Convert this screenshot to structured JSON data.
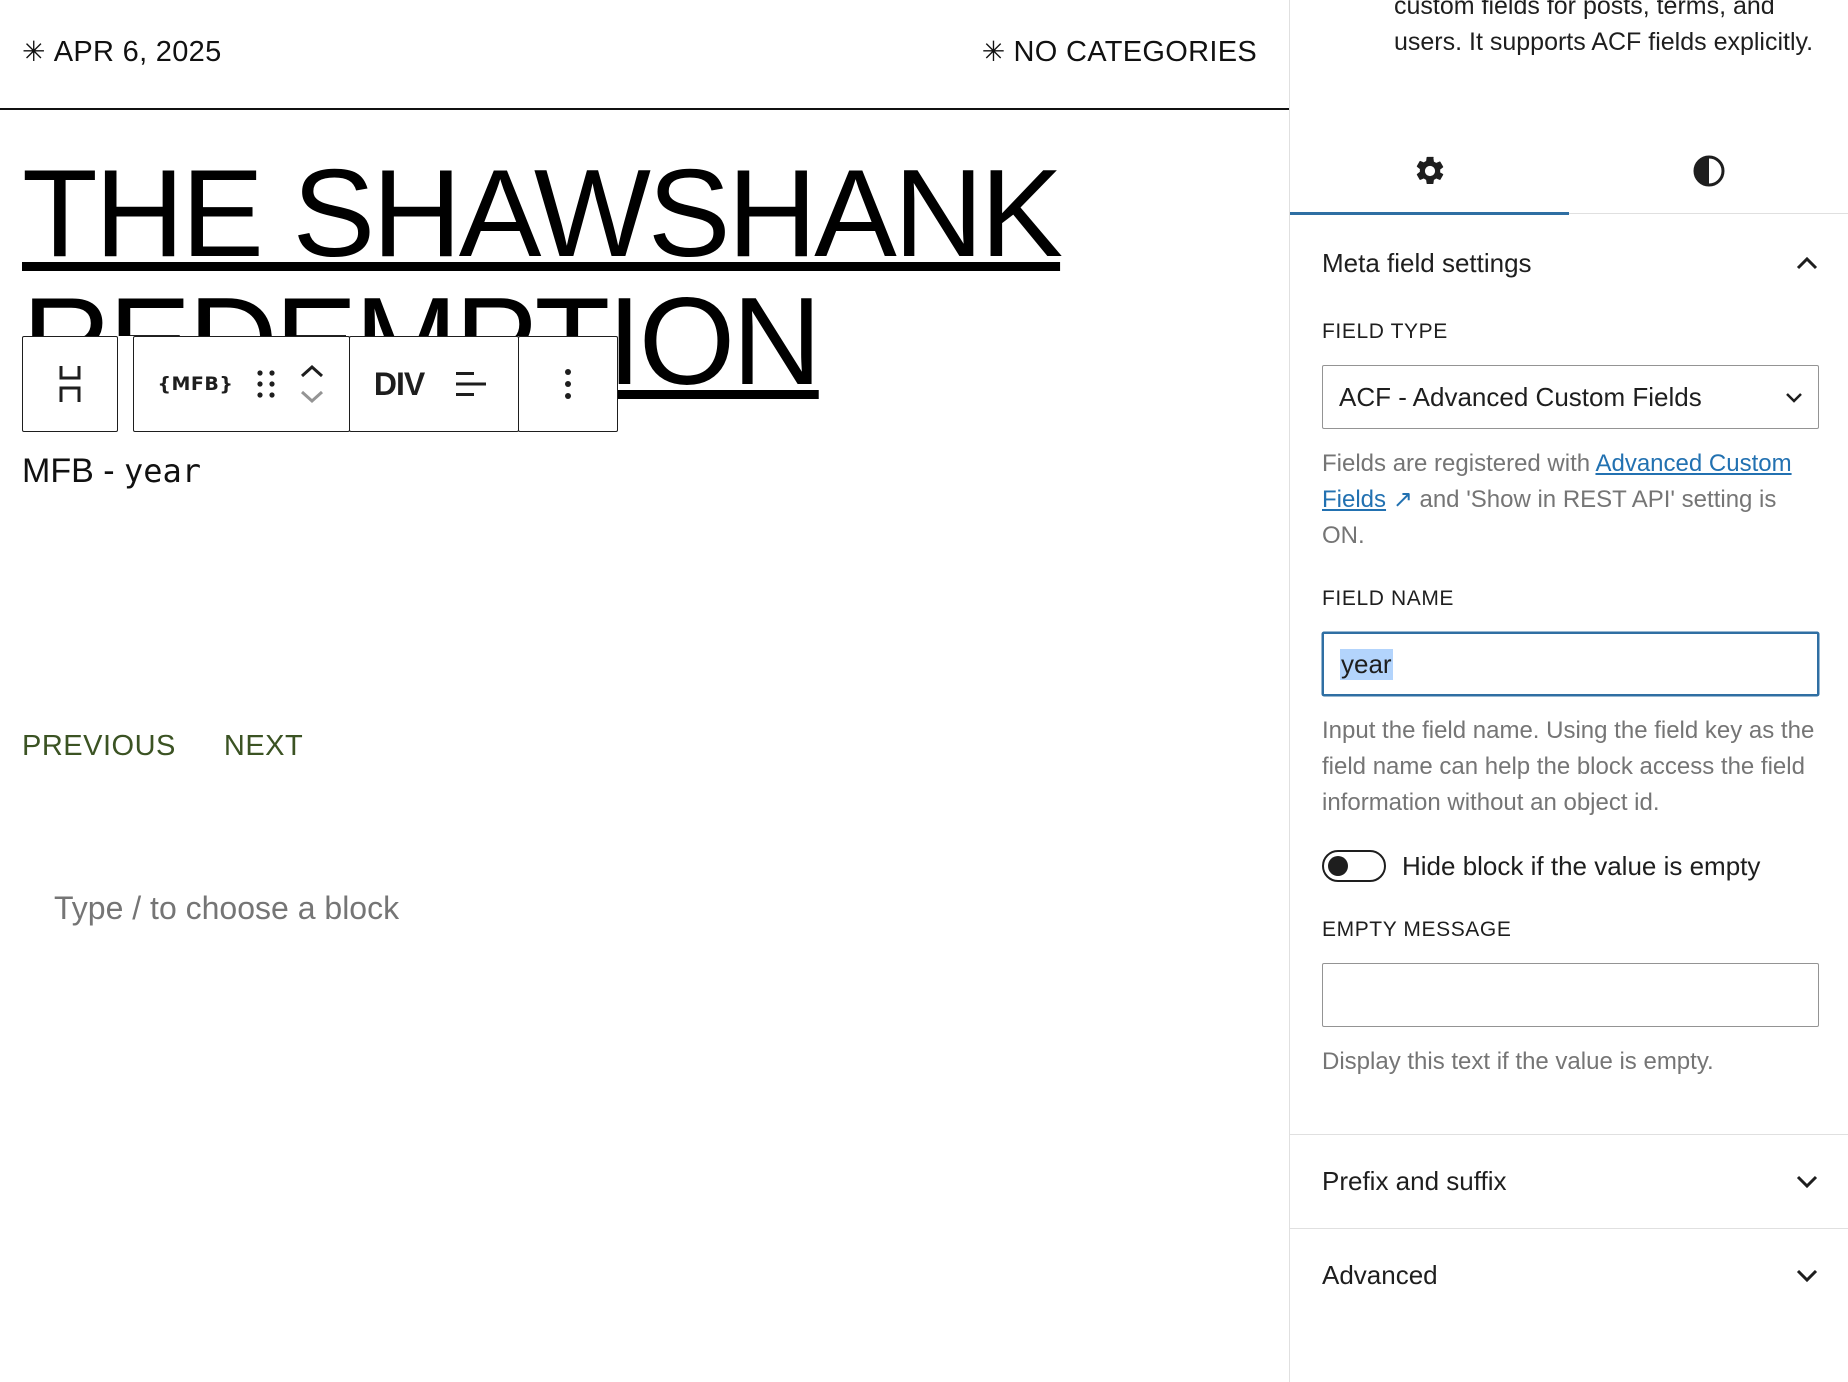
{
  "post_meta": {
    "date": "APR 6, 2025",
    "categories": "NO CATEGORIES"
  },
  "post_title": "THE SHAWSHANK REDEMPTION",
  "toolbar": {
    "block_label": "{MFB}",
    "tag_label": "DIV"
  },
  "mfb_output": {
    "prefix": "MFB - ",
    "field": "year"
  },
  "pagination": {
    "previous": "PREVIOUS",
    "next": "NEXT"
  },
  "block_placeholder": "Type / to choose a block",
  "sidebar": {
    "description": "custom fields for posts, terms, and users. It supports ACF fields explicitly.",
    "tabs": [
      {
        "icon": "gear-icon",
        "active": true
      },
      {
        "icon": "contrast-icon",
        "active": false
      }
    ],
    "panel_title": "Meta field settings",
    "field_type": {
      "label": "FIELD TYPE",
      "value": "ACF - Advanced Custom Fields",
      "help_prefix": "Fields are registered with ",
      "help_link": "Advanced Custom Fields",
      "help_suffix": " and 'Show in REST API' setting is ON."
    },
    "field_name": {
      "label": "FIELD NAME",
      "value": "year",
      "help": "Input the field name. Using the field key as the field name can help the block access the field information without an object id."
    },
    "hide_toggle": {
      "label": "Hide block if the value is empty",
      "checked": false
    },
    "empty_message": {
      "label": "EMPTY MESSAGE",
      "value": "",
      "help": "Display this text if the value is empty."
    },
    "sections": [
      {
        "title": "Prefix and suffix"
      },
      {
        "title": "Advanced"
      }
    ]
  },
  "colors": {
    "accent": "#2f6fa3",
    "link": "#2271b1",
    "pagination": "#3b5323",
    "muted_text": "#757575",
    "selection": "#b3d4fc"
  }
}
